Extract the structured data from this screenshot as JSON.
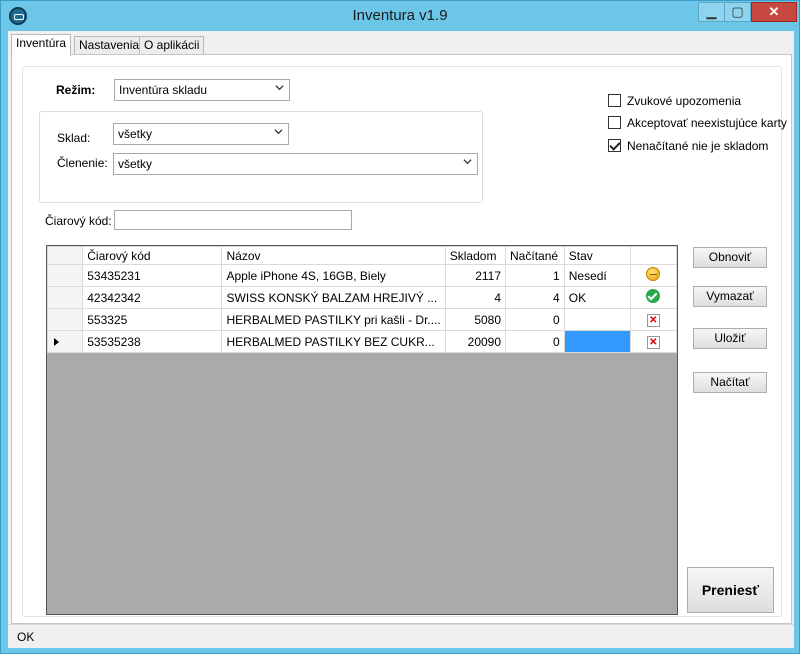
{
  "window": {
    "title": "Inventura v1.9",
    "min_glyph": "▁",
    "max_glyph": "▢",
    "close_glyph": "✕"
  },
  "tabs": [
    {
      "label": "Inventúra",
      "active": true
    },
    {
      "label": "Nastavenia",
      "active": false
    },
    {
      "label": "O aplikácii",
      "active": false
    }
  ],
  "form": {
    "mode_label": "Režim:",
    "mode_value": "Inventúra skladu",
    "warehouse_label": "Sklad:",
    "warehouse_value": "všetky",
    "division_label": "Členenie:",
    "division_value": "všetky",
    "barcode_label": "Čiarový kód:",
    "barcode_value": ""
  },
  "options": [
    {
      "label": "Zvukové upozomenia",
      "checked": false
    },
    {
      "label": "Akceptovať neexistujúce karty",
      "checked": false
    },
    {
      "label": "Nenačítané nie je skladom",
      "checked": true
    }
  ],
  "grid": {
    "columns": [
      "Čiarový kód",
      "Názov",
      "Skladom",
      "Načítané",
      "Stav",
      ""
    ],
    "rows": [
      {
        "barcode": "53435231",
        "name": "Apple iPhone 4S, 16GB, Biely",
        "stock": "2117",
        "loaded": "1",
        "status": "Nesedí",
        "icon": "warning-icon",
        "current": false
      },
      {
        "barcode": "42342342",
        "name": "SWISS KONSKÝ BALZAM HREJIVÝ ...",
        "stock": "4",
        "loaded": "4",
        "status": "OK",
        "icon": "ok-icon",
        "current": false
      },
      {
        "barcode": "553325",
        "name": "HERBALMED PASTILKY pri kašli - Dr....",
        "stock": "5080",
        "loaded": "0",
        "status": "",
        "icon": "error-icon",
        "current": false
      },
      {
        "barcode": "53535238",
        "name": "HERBALMED PASTILKY BEZ CUKR...",
        "stock": "20090",
        "loaded": "0",
        "status": "",
        "icon": "error-icon",
        "current": true
      }
    ]
  },
  "buttons": {
    "refresh": "Obnoviť",
    "delete": "Vymazať",
    "save": "Uložiť",
    "load": "Načítať",
    "transfer": "Preniesť"
  },
  "status": {
    "text": "OK"
  },
  "colors": {
    "accent": "#6cc6e8",
    "selection": "#3399ff",
    "close": "#c7483e"
  }
}
